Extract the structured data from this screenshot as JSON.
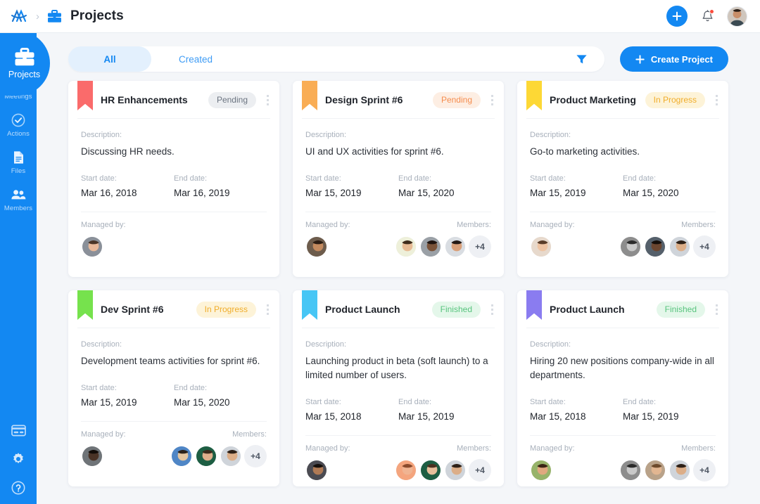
{
  "header": {
    "breadcrumb_logo": "app-logo",
    "breadcrumb_separator": "›",
    "breadcrumb_icon": "briefcase-icon",
    "title": "Projects",
    "add_label": "+",
    "notifications_icon": "bell-icon",
    "avatar_icon": "user-avatar"
  },
  "sidebar": {
    "active": {
      "label": "Projects",
      "icon": "briefcase-icon"
    },
    "items": [
      {
        "label": "Meetings",
        "icon": "calendar-icon"
      },
      {
        "label": "Actions",
        "icon": "check-circle-icon"
      },
      {
        "label": "Files",
        "icon": "file-icon"
      },
      {
        "label": "Members",
        "icon": "people-icon"
      }
    ],
    "bottom": [
      {
        "icon": "billing-card-icon"
      },
      {
        "icon": "gear-icon"
      },
      {
        "icon": "help-circle-icon"
      }
    ]
  },
  "toolbar": {
    "tabs": [
      {
        "label": "All",
        "active": true
      },
      {
        "label": "Created",
        "active": false
      }
    ],
    "filter_icon": "filter-funnel-icon",
    "create_label": "Create Project",
    "create_icon": "plus-icon"
  },
  "card_labels": {
    "description": "Description:",
    "start_date": "Start date:",
    "end_date": "End date:",
    "managed_by": "Managed by:",
    "members": "Members:",
    "menu_icon": "kebab-menu-icon"
  },
  "colors": {
    "accent": "#1388f2",
    "pending_gray_bg": "#eceef1",
    "pending_gray_text": "#6b7480",
    "pending_orange_bg": "#fdeee3",
    "pending_orange_text": "#f58d4f",
    "inprogress_bg": "#fdf3d8",
    "inprogress_text": "#f0ad2b",
    "finished_bg": "#e4f7ea",
    "finished_text": "#58c47e"
  },
  "projects": [
    {
      "title": "HR Enhancements",
      "ribbon_color": "#fa6b6b",
      "status": {
        "label": "Pending",
        "bg": "#eceef1",
        "text": "#6b7480"
      },
      "description": "Discussing HR needs.",
      "start_date": "Mar 16, 2018",
      "end_date": "Mar 16, 2019",
      "manager": {
        "skin": "#e8b99a",
        "hair": "#4a3527",
        "shirt": "#8a9099"
      },
      "has_members": false,
      "members": [],
      "more_count": ""
    },
    {
      "title": "Design Sprint #6",
      "ribbon_color": "#f9ad55",
      "status": {
        "label": "Pending",
        "bg": "#fdeee3",
        "text": "#f58d4f"
      },
      "description": "UI and UX activities for sprint #6.",
      "start_date": "Mar 15, 2019",
      "end_date": "Mar 15, 2020",
      "manager": {
        "skin": "#c38a5f",
        "hair": "#2b1d14",
        "shirt": "#6d5c4c"
      },
      "has_members": true,
      "members": [
        {
          "skin": "#e7bb95",
          "hair": "#3f2c1c",
          "shirt": "#eef0da"
        },
        {
          "skin": "#7a5339",
          "hair": "#1f1410",
          "shirt": "#9aa0a6"
        },
        {
          "skin": "#d9a07a",
          "hair": "#241915",
          "shirt": "#d9dde2"
        }
      ],
      "more_count": "+4"
    },
    {
      "title": "Product Marketing",
      "ribbon_color": "#fdd835",
      "status": {
        "label": "In Progress",
        "bg": "#fdf3d8",
        "text": "#f0ad2b"
      },
      "description": "Go-to marketing activities.",
      "start_date": "Mar 15, 2019",
      "end_date": "Mar 15, 2020",
      "manager": {
        "skin": "#eec4a3",
        "hair": "#593c28",
        "shirt": "#e7d9cc"
      },
      "has_members": true,
      "members": [
        {
          "skin": "#c9c9c9",
          "hair": "#2a2a2a",
          "shirt": "#8d8d8d"
        },
        {
          "skin": "#6b4630",
          "hair": "#150e0a",
          "shirt": "#55606b"
        },
        {
          "skin": "#dcae88",
          "hair": "#2d2017",
          "shirt": "#cfd4da"
        }
      ],
      "more_count": "+4"
    },
    {
      "title": "Dev Sprint #6",
      "ribbon_color": "#76e24d",
      "status": {
        "label": "In Progress",
        "bg": "#fdf3d8",
        "text": "#f0ad2b"
      },
      "description": "Development teams activities for sprint #6.",
      "start_date": "Mar 15, 2019",
      "end_date": "Mar 15, 2020",
      "manager": {
        "skin": "#4a3326",
        "hair": "#120c08",
        "shirt": "#6f7478"
      },
      "has_members": true,
      "members": [
        {
          "skin": "#e3c6a0",
          "hair": "#2a2119",
          "shirt": "#4f86c6"
        },
        {
          "skin": "#dfae8b",
          "hair": "#3c2a1c",
          "shirt": "#1d5e43"
        },
        {
          "skin": "#dcae88",
          "hair": "#2d2017",
          "shirt": "#cfd4da"
        }
      ],
      "more_count": "+4"
    },
    {
      "title": "Product Launch",
      "ribbon_color": "#47c6f5",
      "status": {
        "label": "Finished",
        "bg": "#e4f7ea",
        "text": "#58c47e"
      },
      "description": "Launching product in beta (soft launch) to a limited number of users.",
      "start_date": "Mar 15, 2018",
      "end_date": "Mar 15, 2019",
      "manager": {
        "skin": "#b07a55",
        "hair": "#16100c",
        "shirt": "#4b4b52"
      },
      "has_members": true,
      "members": [
        {
          "skin": "#f0b492",
          "hair": "#8a4a2c",
          "shirt": "#f4a57e"
        },
        {
          "skin": "#e6bf9b",
          "hair": "#4a3220",
          "shirt": "#1d5e43"
        },
        {
          "skin": "#dcae88",
          "hair": "#2d2017",
          "shirt": "#cfd4da"
        }
      ],
      "more_count": "+4"
    },
    {
      "title": "Product Launch",
      "ribbon_color": "#8a7cf0",
      "status": {
        "label": "Finished",
        "bg": "#e4f7ea",
        "text": "#58c47e"
      },
      "description": "Hiring 20 new positions company-wide in all departments.",
      "start_date": "Mar 15, 2018",
      "end_date": "Mar 15, 2019",
      "manager": {
        "skin": "#e0a87f",
        "hair": "#3a2415",
        "shirt": "#97b36a"
      },
      "has_members": true,
      "members": [
        {
          "skin": "#c9c9c9",
          "hair": "#2a2a2a",
          "shirt": "#8d8d8d"
        },
        {
          "skin": "#e2b691",
          "hair": "#6d4a2c",
          "shirt": "#b9a289"
        },
        {
          "skin": "#dcae88",
          "hair": "#2d2017",
          "shirt": "#cfd4da"
        }
      ],
      "more_count": "+4"
    }
  ]
}
